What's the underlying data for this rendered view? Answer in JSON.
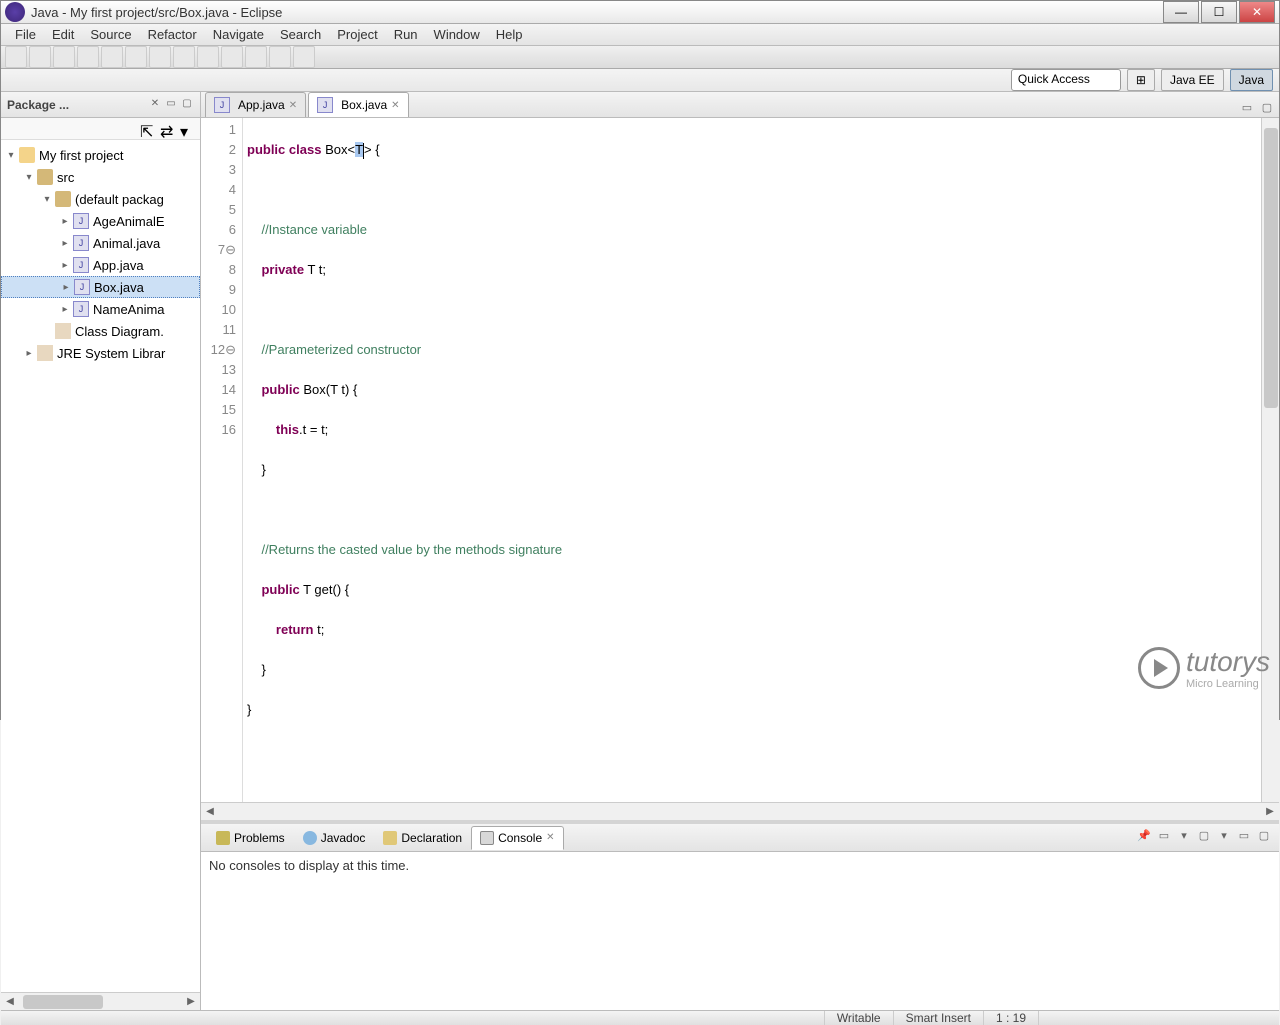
{
  "titlebar": {
    "text": "Java - My first project/src/Box.java - Eclipse"
  },
  "menus": [
    "File",
    "Edit",
    "Source",
    "Refactor",
    "Navigate",
    "Search",
    "Project",
    "Run",
    "Window",
    "Help"
  ],
  "perspective": {
    "quick_access": "Quick Access",
    "java_ee": "Java EE",
    "java": "Java"
  },
  "package_explorer": {
    "title": "Package ...",
    "project": "My first project",
    "src": "src",
    "pkg": "(default packag",
    "files": [
      "AgeAnimalE",
      "Animal.java",
      "App.java",
      "Box.java",
      "NameAnima"
    ],
    "class_diagram": "Class Diagram.",
    "jre": "JRE System Librar"
  },
  "editor": {
    "tabs": [
      {
        "label": "App.java",
        "active": false
      },
      {
        "label": "Box.java",
        "active": true
      }
    ],
    "lines": [
      {
        "n": "1"
      },
      {
        "n": "2"
      },
      {
        "n": "3"
      },
      {
        "n": "4"
      },
      {
        "n": "5"
      },
      {
        "n": "6"
      },
      {
        "n": "7⊖"
      },
      {
        "n": "8"
      },
      {
        "n": "9"
      },
      {
        "n": "10"
      },
      {
        "n": "11"
      },
      {
        "n": "12⊖"
      },
      {
        "n": "13"
      },
      {
        "n": "14"
      },
      {
        "n": "15"
      },
      {
        "n": "16"
      }
    ],
    "code": {
      "l1_kw1": "public",
      "l1_kw2": "class",
      "l1_name": "Box<",
      "l1_t": "T",
      "l1_end": "> {",
      "l3": "//Instance variable",
      "l4_kw": "private",
      "l4_rest": " T t;",
      "l6": "//Parameterized constructor",
      "l7_kw": "public",
      "l7_rest": " Box(T t) {",
      "l8_kw": "this",
      "l8_rest": ".t = t;",
      "l9": "}",
      "l11": "//Returns the casted value by the methods signature",
      "l12_kw": "public",
      "l12_rest": " T get() {",
      "l13_kw": "return",
      "l13_rest": " t;",
      "l14": "}",
      "l15": "}"
    }
  },
  "bottom": {
    "tabs": [
      "Problems",
      "Javadoc",
      "Declaration",
      "Console"
    ],
    "console_msg": "No consoles to display at this time."
  },
  "status": {
    "writable": "Writable",
    "insert": "Smart Insert",
    "pos": "1 : 19"
  },
  "watermark": {
    "brand": "tutorys",
    "tag": "Micro Learning"
  }
}
